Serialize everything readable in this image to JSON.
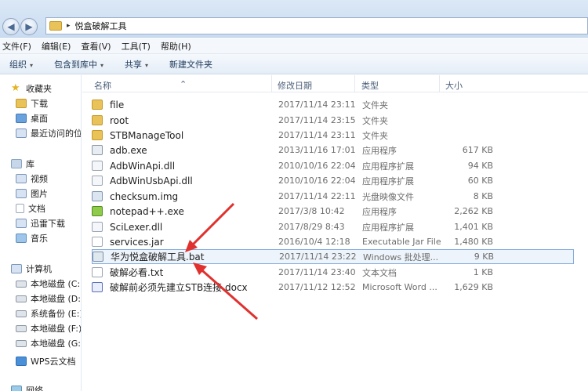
{
  "address": {
    "path": "悦盒破解工具",
    "separator": "▸"
  },
  "menu": [
    "文件(F)",
    "编辑(E)",
    "查看(V)",
    "工具(T)",
    "帮助(H)"
  ],
  "toolbar": [
    {
      "label": "组织",
      "caret": "▾"
    },
    {
      "label": "包含到库中",
      "caret": "▾"
    },
    {
      "label": "共享",
      "caret": "▾"
    },
    {
      "label": "新建文件夹",
      "caret": ""
    }
  ],
  "sidebar": {
    "favorites": "收藏夹",
    "favorites_items": [
      "下载",
      "桌面",
      "最近访问的位"
    ],
    "library": "库",
    "library_items": [
      "视频",
      "图片",
      "文档",
      "迅雷下载",
      "音乐"
    ],
    "computer": "计算机",
    "drives": [
      "本地磁盘 (C:)",
      "本地磁盘 (D:)",
      "系统备份 (E:)",
      "本地磁盘 (F:)",
      "本地磁盘 (G:)"
    ],
    "wps": "WPS云文档",
    "network": "网络"
  },
  "columns": {
    "name": "名称",
    "date": "修改日期",
    "type": "类型",
    "size": "大小"
  },
  "files": [
    {
      "name": "file",
      "date": "2017/11/14 23:11",
      "type": "文件夹",
      "size": "",
      "icon": "folder"
    },
    {
      "name": "root",
      "date": "2017/11/14 23:15",
      "type": "文件夹",
      "size": "",
      "icon": "folder"
    },
    {
      "name": "STBManageTool",
      "date": "2017/11/14 23:11",
      "type": "文件夹",
      "size": "",
      "icon": "folder"
    },
    {
      "name": "adb.exe",
      "date": "2013/11/16 17:01",
      "type": "应用程序",
      "size": "617 KB",
      "icon": "exe"
    },
    {
      "name": "AdbWinApi.dll",
      "date": "2010/10/16 22:04",
      "type": "应用程序扩展",
      "size": "94 KB",
      "icon": "dll"
    },
    {
      "name": "AdbWinUsbApi.dll",
      "date": "2010/10/16 22:04",
      "type": "应用程序扩展",
      "size": "60 KB",
      "icon": "dll"
    },
    {
      "name": "checksum.img",
      "date": "2017/11/14 22:11",
      "type": "光盘映像文件",
      "size": "8 KB",
      "icon": "img"
    },
    {
      "name": "notepad++.exe",
      "date": "2017/3/8 10:42",
      "type": "应用程序",
      "size": "2,262 KB",
      "icon": "npp"
    },
    {
      "name": "SciLexer.dll",
      "date": "2017/8/29 8:43",
      "type": "应用程序扩展",
      "size": "1,401 KB",
      "icon": "dll"
    },
    {
      "name": "services.jar",
      "date": "2016/10/4 12:18",
      "type": "Executable Jar File",
      "size": "1,480 KB",
      "icon": "jar"
    },
    {
      "name": "华为悦盒破解工具.bat",
      "date": "2017/11/14 23:22",
      "type": "Windows 批处理...",
      "size": "9 KB",
      "icon": "bat"
    },
    {
      "name": "破解必看.txt",
      "date": "2017/11/14 23:40",
      "type": "文本文档",
      "size": "1 KB",
      "icon": "txt"
    },
    {
      "name": "破解前必须先建立STB连接.docx",
      "date": "2017/11/12 12:52",
      "type": "Microsoft Word ...",
      "size": "1,629 KB",
      "icon": "docx"
    }
  ],
  "selected_index": 10,
  "arrow_color": "#e0312f"
}
